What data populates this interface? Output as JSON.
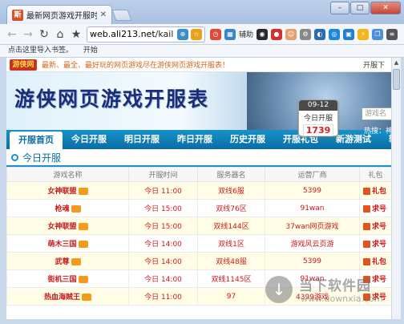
{
  "browser": {
    "tab_title": "最新网页游戏开服时间表",
    "tab_favicon_text": "斯",
    "url_host": "web.ali213.net",
    "url_path": "/kail",
    "bookmarks": [
      "点击这里导入书签。",
      "开始"
    ],
    "ext_label": "辅助",
    "window_buttons": [
      "–",
      "□",
      "✕"
    ]
  },
  "page": {
    "logo_text": "游侠网",
    "slogan": "最新、最全、最好玩的网页游戏尽在游侠网页游戏开服表！",
    "open_link": "开服下",
    "banner_title": "游侠网页游戏开服表",
    "date_card": {
      "date": "09-12",
      "label": "今日开服",
      "count": "1739"
    },
    "search_placeholder": "游戏名",
    "hot_words": "热搜：神",
    "nav": [
      "开服首页",
      "今日开服",
      "明日开服",
      "昨日开服",
      "历史开服",
      "开服礼包",
      "新游测试",
      "辅助工"
    ],
    "section_title": "今日开服",
    "table": {
      "headers": [
        "游戏名称",
        "开服时间",
        "服务器名",
        "运营厂商",
        "礼包"
      ],
      "rows": [
        {
          "game": "女神联盟",
          "time": "今日 11:00",
          "server": "双线6服",
          "operator": "5399",
          "gift": "礼包"
        },
        {
          "game": "枪魂",
          "time": "今日 15:00",
          "server": "双线76区",
          "operator": "91wan",
          "gift": "求号"
        },
        {
          "game": "女神联盟",
          "time": "今日 15:00",
          "server": "双线144区",
          "operator": "37wan网页游戏",
          "gift": "求号"
        },
        {
          "game": "萌木三国",
          "time": "今日 14:00",
          "server": "双线1区",
          "operator": "游戏风云页游",
          "gift": "求号"
        },
        {
          "game": "武尊",
          "time": "今日 14:00",
          "server": "双线48服",
          "operator": "5399",
          "gift": "礼包"
        },
        {
          "game": "街机三国",
          "time": "今日 14:00",
          "server": "双线1145区",
          "operator": "91wan",
          "gift": "求号"
        },
        {
          "game": "热血海贼王",
          "time": "今日 11:00",
          "server": "97",
          "operator": "4399游戏",
          "gift": "求号"
        }
      ]
    }
  },
  "watermark": {
    "title": "当下软件园",
    "url": "www.downxia.com"
  }
}
